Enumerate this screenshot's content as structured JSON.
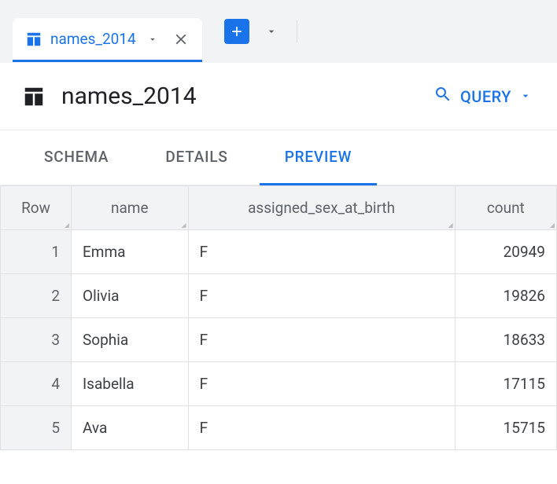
{
  "topbar": {
    "tab_label": "names_2014"
  },
  "header": {
    "title": "names_2014",
    "query_label": "QUERY"
  },
  "nav_tabs": {
    "schema": "SCHEMA",
    "details": "DETAILS",
    "preview": "PREVIEW"
  },
  "table": {
    "columns": {
      "row": "Row",
      "name": "name",
      "assigned_sex": "assigned_sex_at_birth",
      "count": "count"
    },
    "rows": [
      {
        "row": "1",
        "name": "Emma",
        "assigned_sex": "F",
        "count": "20949"
      },
      {
        "row": "2",
        "name": "Olivia",
        "assigned_sex": "F",
        "count": "19826"
      },
      {
        "row": "3",
        "name": "Sophia",
        "assigned_sex": "F",
        "count": "18633"
      },
      {
        "row": "4",
        "name": "Isabella",
        "assigned_sex": "F",
        "count": "17115"
      },
      {
        "row": "5",
        "name": "Ava",
        "assigned_sex": "F",
        "count": "15715"
      }
    ]
  }
}
